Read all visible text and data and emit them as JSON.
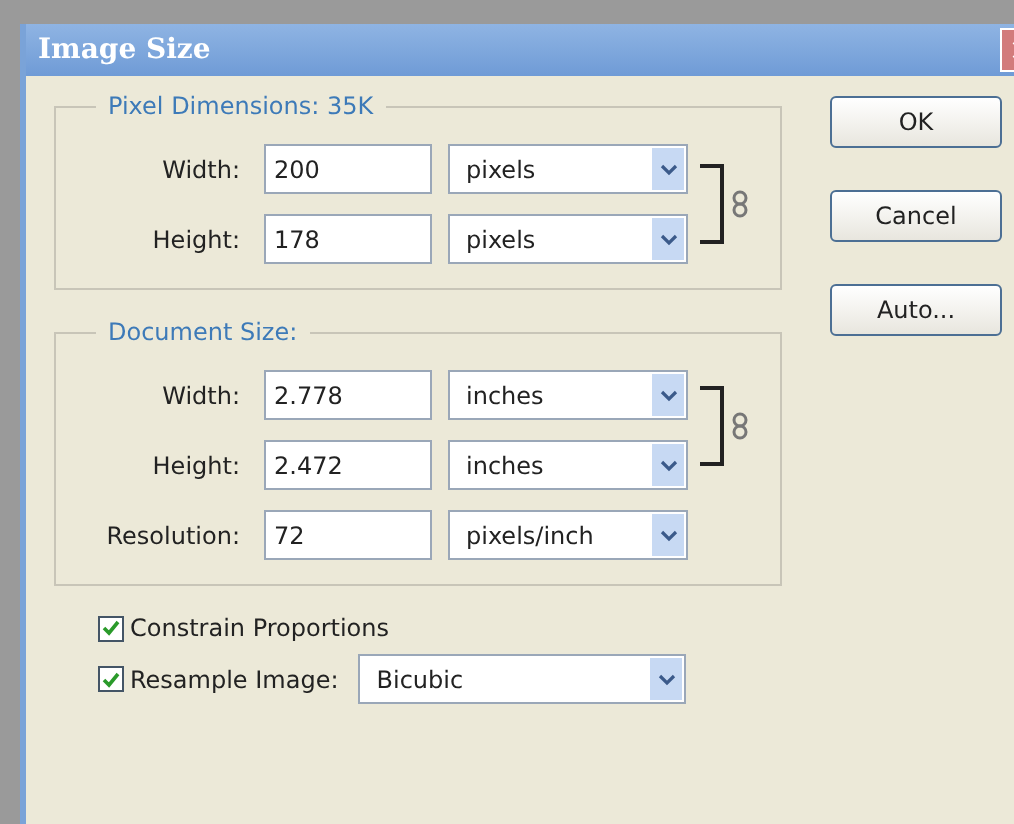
{
  "window": {
    "title": "Image Size"
  },
  "groups": [
    {
      "legend": "Pixel Dimensions:",
      "value": "35K",
      "linked": true,
      "rows": [
        {
          "label": "Width:",
          "value": "200",
          "unit": "pixels"
        },
        {
          "label": "Height:",
          "value": "178",
          "unit": "pixels"
        }
      ]
    },
    {
      "legend": "Document Size:",
      "linked": true,
      "rows": [
        {
          "label": "Width:",
          "value": "2.778",
          "unit": "inches"
        },
        {
          "label": "Height:",
          "value": "2.472",
          "unit": "inches"
        },
        {
          "label": "Resolution:",
          "value": "72",
          "unit": "pixels/inch"
        }
      ]
    }
  ],
  "options": [
    {
      "label": "Constrain Proportions",
      "checked": true
    },
    {
      "label": "Resample Image:",
      "checked": true,
      "select": "Bicubic"
    }
  ],
  "buttons": [
    "OK",
    "Cancel",
    "Auto..."
  ]
}
